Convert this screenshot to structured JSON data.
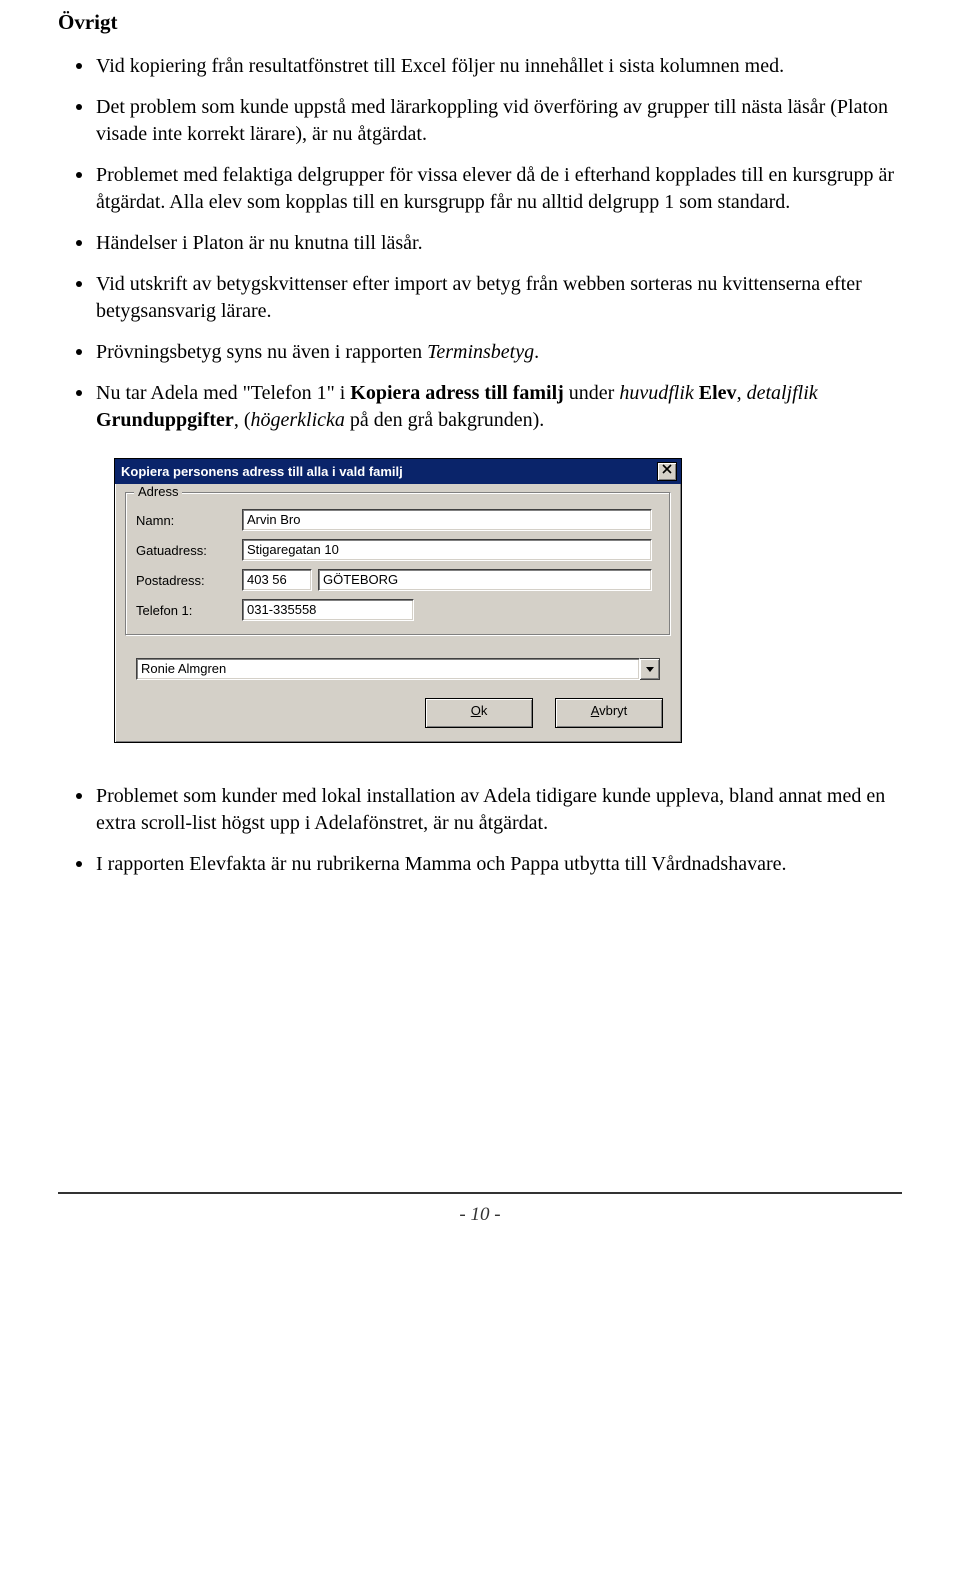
{
  "heading": "Övrigt",
  "bullets_top": [
    {
      "text": "Vid kopiering från resultatfönstret till Excel följer nu innehållet i sista kolumnen med."
    },
    {
      "text": "Det problem som kunde uppstå med lärarkoppling vid överföring av grupper till nästa läsår (Platon visade inte korrekt lärare), är nu åtgärdat."
    },
    {
      "text": "Problemet med felaktiga delgrupper för vissa elever då de i efterhand kopplades till en kursgrupp är åtgärdat. Alla elev som kopplas till en kursgrupp får nu alltid delgrupp 1 som standard."
    },
    {
      "text": "Händelser i Platon är nu knutna till läsår."
    },
    {
      "text": "Vid utskrift av betygskvittenser efter import av betyg från webben sorteras nu kvittenserna efter betygsansvarig lärare."
    },
    {
      "pre": "Prövningsbetyg syns nu även i rapporten ",
      "it1": "Terminsbetyg",
      "post": "."
    },
    {
      "p1": "Nu tar Adela med \"Telefon 1\" i ",
      "b1": "Kopiera adress till familj",
      "p2": " under ",
      "it1": "huvudflik",
      "p3": " ",
      "b2": "Elev",
      "p4": ", ",
      "it2": "detaljflik",
      "p5": " ",
      "b3": "Grunduppgifter",
      "p6": ", (",
      "it3": "högerklicka",
      "p7": " på den grå bakgrunden)."
    }
  ],
  "dialog": {
    "title": "Kopiera personens adress till alla i vald familj",
    "group_legend": "Adress",
    "labels": {
      "name": "Namn:",
      "street": "Gatuadress:",
      "postal": "Postadress:",
      "phone": "Telefon 1:"
    },
    "values": {
      "name": "Arvin Bro",
      "street": "Stigaregatan 10",
      "postcode": "403 56",
      "city": "GÖTEBORG",
      "phone": "031-335558"
    },
    "combo_value": "Ronie Almgren",
    "buttons": {
      "ok_u": "O",
      "ok_rest": "k",
      "cancel_u": "A",
      "cancel_rest": "vbryt"
    }
  },
  "bullets_bottom": [
    {
      "text": "Problemet som kunder med lokal installation av Adela tidigare kunde uppleva, bland annat med en extra scroll-list högst upp i Adelafönstret, är nu åtgärdat."
    },
    {
      "text": "I rapporten Elevfakta är nu rubrikerna Mamma och Pappa utbytta till Vårdnadshavare."
    }
  ],
  "page_number": "- 10 -"
}
